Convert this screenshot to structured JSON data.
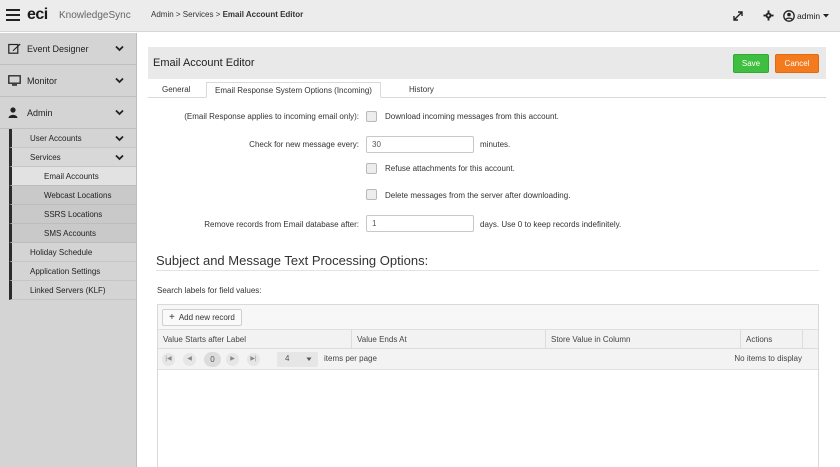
{
  "topbar": {
    "logo_mark": "eci",
    "logo_text": "KnowledgeSync",
    "breadcrumb_prefix": "Admin > Services > ",
    "breadcrumb_current": "Email Account Editor",
    "user_label": "admin"
  },
  "sidebar": {
    "main_items": [
      {
        "label": "Event Designer",
        "icon": "edit-icon"
      },
      {
        "label": "Monitor",
        "icon": "monitor-icon"
      },
      {
        "label": "Admin",
        "icon": "user-icon"
      }
    ],
    "admin_items": [
      {
        "label": "User Accounts"
      },
      {
        "label": "Services"
      }
    ],
    "services_items": [
      {
        "label": "Email Accounts"
      },
      {
        "label": "Webcast Locations"
      },
      {
        "label": "SSRS Locations"
      },
      {
        "label": "SMS Accounts"
      }
    ],
    "other_items": [
      {
        "label": "Holiday Schedule"
      },
      {
        "label": "Application Settings"
      },
      {
        "label": "Linked Servers (KLF)"
      }
    ]
  },
  "panel": {
    "title": "Email Account Editor",
    "save_label": "Save",
    "cancel_label": "Cancel",
    "tabs": [
      {
        "label": "General",
        "active": false
      },
      {
        "label": "Email Response System Options (Incoming)",
        "active": true
      },
      {
        "label": "History",
        "active": false
      }
    ]
  },
  "form": {
    "email_response_label": "(Email Response applies to incoming email only):",
    "download_label": "Download incoming messages from this account.",
    "download_checked": false,
    "check_label": "Check for new message every:",
    "check_value": "30",
    "check_suffix": "minutes.",
    "refuse_label": "Refuse attachments for this account.",
    "refuse_checked": false,
    "delete_label": "Delete messages from the server after downloading.",
    "delete_checked": false,
    "remove_label": "Remove records from Email database after:",
    "remove_value": "1",
    "remove_suffix": "days. Use 0 to keep records indefinitely."
  },
  "section": {
    "title": "Subject and Message Text Processing Options:",
    "search_labels": "Search labels for field values:"
  },
  "grid": {
    "add_label": "Add new record",
    "columns": [
      "Value Starts after Label",
      "Value Ends At",
      "Store Value in Column",
      "Actions"
    ],
    "page_number": "0",
    "page_size": "4",
    "items_per_page": "items per page",
    "no_items": "No items to display"
  },
  "colors": {
    "save": "#3fbf3f",
    "cancel": "#f37b1e",
    "sidebar_bg": "#d4d4d4"
  }
}
